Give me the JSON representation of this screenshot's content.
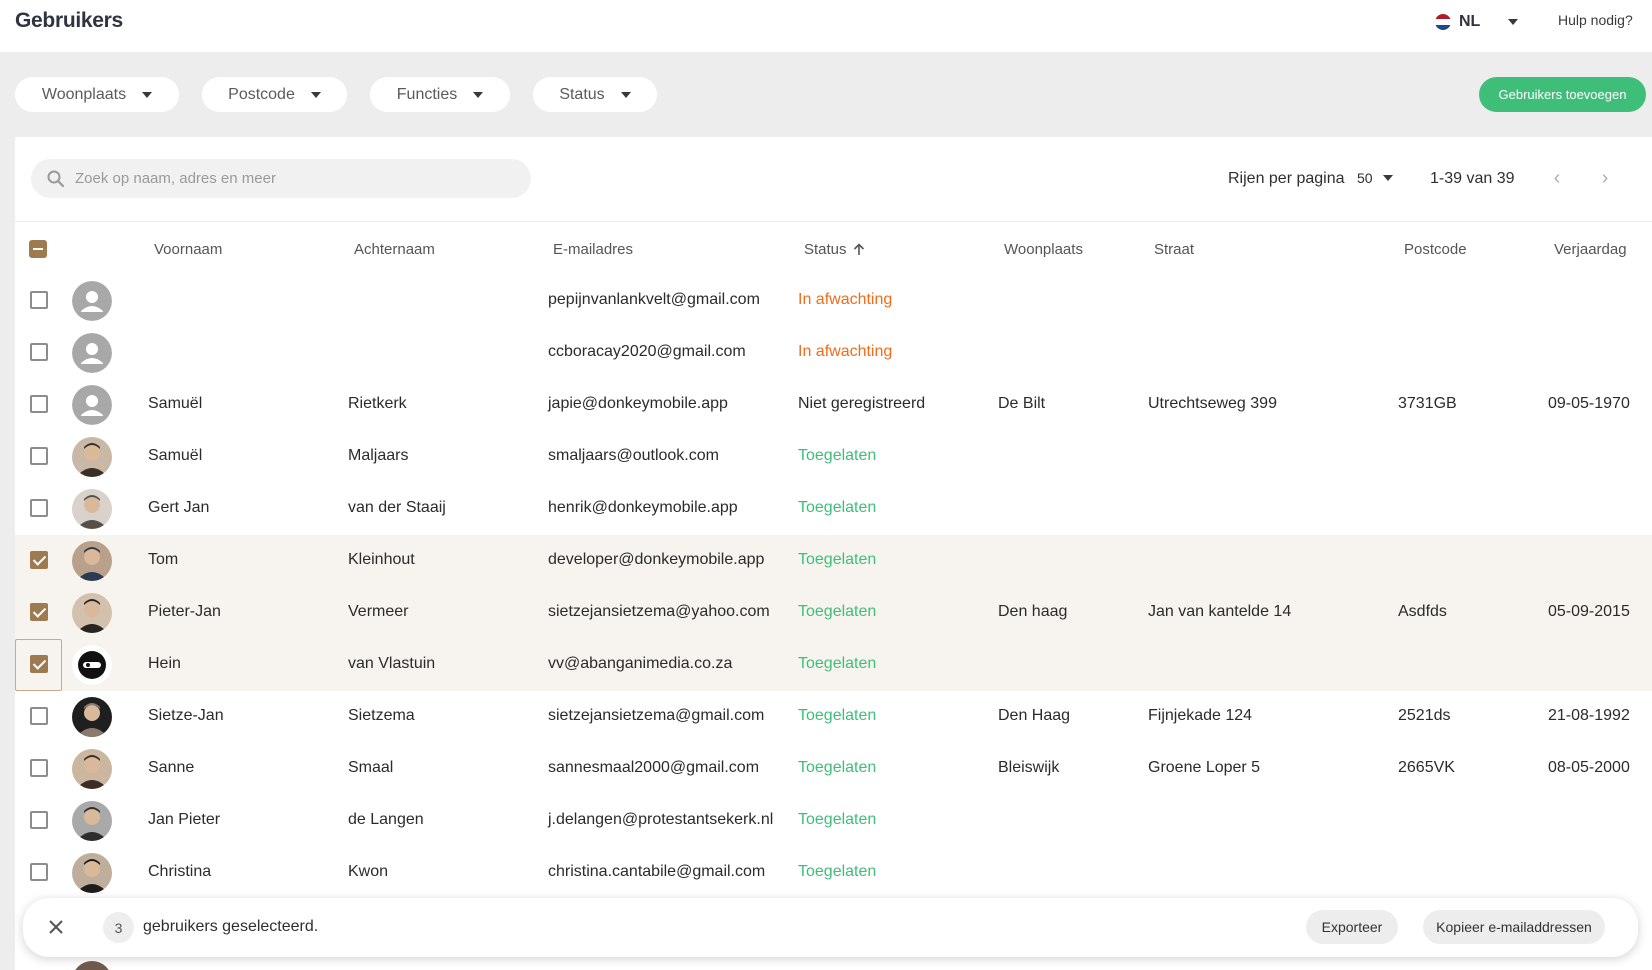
{
  "header": {
    "title": "Gebruikers",
    "language": "NL",
    "help": "Hulp nodig?"
  },
  "filters": [
    "Woonplaats",
    "Postcode",
    "Functies",
    "Status"
  ],
  "add_button": "Gebruikers toevoegen",
  "search": {
    "placeholder": "Zoek op naam, adres en meer",
    "value": ""
  },
  "pagination": {
    "rows_label": "Rijen per pagina",
    "rows_per_page": "50",
    "range": "1-39 van 39"
  },
  "columns": {
    "firstname": "Voornaam",
    "lastname": "Achternaam",
    "email": "E-mailadres",
    "status": "Status",
    "city": "Woonplaats",
    "street": "Straat",
    "postcode": "Postcode",
    "birthday": "Verjaardag"
  },
  "status_colors": {
    "In afwachting": "#f06d1a",
    "Toegelaten": "#3fbe7a",
    "Niet geregistreerd": "#2b2b2b"
  },
  "accent_color": "#3fbe7a",
  "checkbox_color": "#9d7a4f",
  "users": [
    {
      "firstname": "",
      "lastname": "",
      "email": "pepijnvanlankvelt@gmail.com",
      "status": "In afwachting",
      "city": "",
      "street": "",
      "postcode": "",
      "birthday": "",
      "selected": false,
      "avatar": "placeholder-icon"
    },
    {
      "firstname": "",
      "lastname": "",
      "email": "ccboracay2020@gmail.com",
      "status": "In afwachting",
      "city": "",
      "street": "",
      "postcode": "",
      "birthday": "",
      "selected": false,
      "avatar": "placeholder-icon"
    },
    {
      "firstname": "Samuël",
      "lastname": "Rietkerk",
      "email": "japie@donkeymobile.app",
      "status": "Niet geregistreerd",
      "city": "De Bilt",
      "street": "Utrechtseweg 399",
      "postcode": "3731GB",
      "birthday": "09-05-1970",
      "selected": false,
      "avatar": "placeholder-icon"
    },
    {
      "firstname": "Samuël",
      "lastname": "Maljaars",
      "email": "smaljaars@outlook.com",
      "status": "Toegelaten",
      "city": "",
      "street": "",
      "postcode": "",
      "birthday": "",
      "selected": false,
      "avatar": "photo"
    },
    {
      "firstname": "Gert Jan",
      "lastname": "van der Staaij",
      "email": "henrik@donkeymobile.app",
      "status": "Toegelaten",
      "city": "",
      "street": "",
      "postcode": "",
      "birthday": "",
      "selected": false,
      "avatar": "photo"
    },
    {
      "firstname": "Tom",
      "lastname": "Kleinhout",
      "email": "developer@donkeymobile.app",
      "status": "Toegelaten",
      "city": "",
      "street": "",
      "postcode": "",
      "birthday": "",
      "selected": true,
      "avatar": "photo"
    },
    {
      "firstname": "Pieter-Jan",
      "lastname": "Vermeer",
      "email": "sietzejansietzema@yahoo.com",
      "status": "Toegelaten",
      "city": "Den haag",
      "street": "Jan van kantelde 14",
      "postcode": "Asdfds",
      "birthday": "05-09-2015",
      "selected": true,
      "avatar": "photo"
    },
    {
      "firstname": "Hein",
      "lastname": "van Vlastuin",
      "email": "vv@abanganimedia.co.za",
      "status": "Toegelaten",
      "city": "",
      "street": "",
      "postcode": "",
      "birthday": "",
      "selected": true,
      "avatar": "logo"
    },
    {
      "firstname": "Sietze-Jan",
      "lastname": "Sietzema",
      "email": "sietzejansietzema@gmail.com",
      "status": "Toegelaten",
      "city": "Den Haag",
      "street": "Fijnjekade 124",
      "postcode": "2521ds",
      "birthday": "21-08-1992",
      "selected": false,
      "avatar": "photo"
    },
    {
      "firstname": "Sanne",
      "lastname": "Smaal",
      "email": "sannesmaal2000@gmail.com",
      "status": "Toegelaten",
      "city": "Bleiswijk",
      "street": "Groene Loper 5",
      "postcode": "2665VK",
      "birthday": "08-05-2000",
      "selected": false,
      "avatar": "photo"
    },
    {
      "firstname": "Jan Pieter",
      "lastname": "de Langen",
      "email": "j.delangen@protestantsekerk.nl",
      "status": "Toegelaten",
      "city": "",
      "street": "",
      "postcode": "",
      "birthday": "",
      "selected": false,
      "avatar": "photo"
    },
    {
      "firstname": "Christina",
      "lastname": "Kwon",
      "email": "christina.cantabile@gmail.com",
      "status": "Toegelaten",
      "city": "",
      "street": "",
      "postcode": "",
      "birthday": "",
      "selected": false,
      "avatar": "photo"
    }
  ],
  "selection_bar": {
    "count": "3",
    "message": "gebruikers geselecteerd.",
    "export": "Exporteer",
    "copy": "Kopieer e-mailaddressen"
  }
}
